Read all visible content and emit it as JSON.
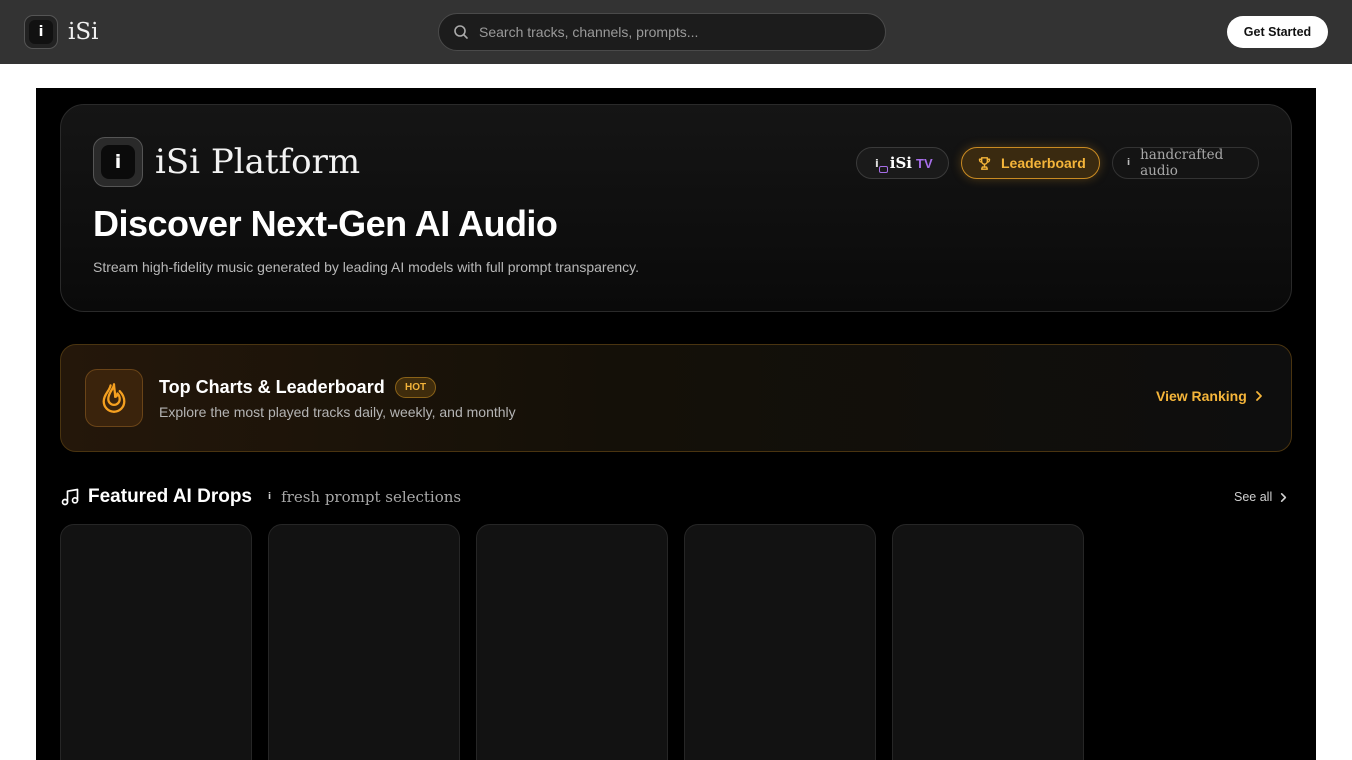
{
  "topbar": {
    "brand_name": "iSi",
    "search_placeholder": "Search tracks, channels, prompts...",
    "get_started_label": "Get Started"
  },
  "hero": {
    "brand": "iSi Platform",
    "title": "Discover Next-Gen AI Audio",
    "subtitle": "Stream high-fidelity music generated by leading AI models with full prompt transparency.",
    "pills": {
      "tv_isi": "iSi",
      "tv_label": "TV",
      "leaderboard_label": "Leaderboard",
      "handcrafted_label": "handcrafted audio"
    }
  },
  "charts_banner": {
    "title": "Top Charts & Leaderboard",
    "badge": "HOT",
    "subtitle": "Explore the most played tracks daily, weekly, and monthly",
    "cta": "View Ranking"
  },
  "featured": {
    "title": "Featured AI Drops",
    "subtitle": "fresh prompt selections",
    "see_all": "See all",
    "cards": 5
  },
  "colors": {
    "accent_gold": "#f5b53a",
    "accent_purple": "#a66ee8",
    "topbar_bg": "#333333"
  },
  "icons": [
    "logo-i-icon",
    "search-icon",
    "tv-icon",
    "trophy-icon",
    "flame-icon",
    "chevron-right-icon",
    "music-note-icon"
  ]
}
